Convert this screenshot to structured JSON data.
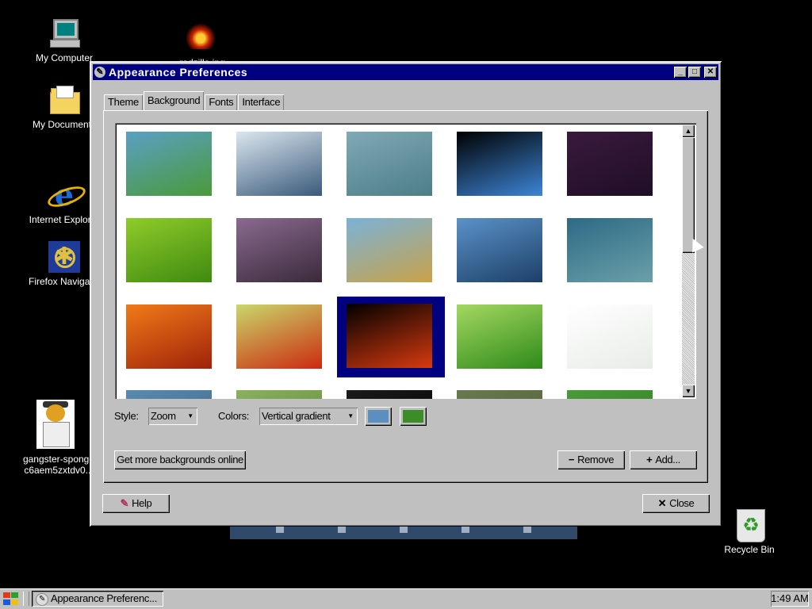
{
  "desktop": {
    "icons": [
      {
        "label": "My Computer"
      },
      {
        "label": "My Documents"
      },
      {
        "label": "Internet Explorer"
      },
      {
        "label": "Firefox Navigator"
      },
      {
        "label": "gangster-sponge",
        "label2": "c6aem5zxtdv0..."
      },
      {
        "label": "radzilla.jpg"
      },
      {
        "label": "Recycle Bin"
      }
    ]
  },
  "window": {
    "title": "Appearance Preferences",
    "controls": {
      "minimize": "_",
      "maximize": "□",
      "close": "✕"
    },
    "tabs": [
      {
        "label": "Theme"
      },
      {
        "label": "Background",
        "active": true
      },
      {
        "label": "Fonts"
      },
      {
        "label": "Interface"
      }
    ],
    "thumbnails": [
      {
        "name": "green-blue gradient",
        "colors": [
          "#5a9fc4",
          "#4a9a3a"
        ]
      },
      {
        "name": "water drop",
        "colors": [
          "#dbe6ef",
          "#3a5a7a"
        ]
      },
      {
        "name": "teal blur",
        "colors": [
          "#7fa9b6",
          "#4d7e86"
        ]
      },
      {
        "name": "arch rainbow",
        "colors": [
          "#000000",
          "#3d85d6"
        ]
      },
      {
        "name": "purple bubbles",
        "colors": [
          "#3a1a3e",
          "#1f0d26"
        ]
      },
      {
        "name": "green leaf",
        "colors": [
          "#8fcc2a",
          "#3f8a10"
        ]
      },
      {
        "name": "nebula",
        "colors": [
          "#8a6a90",
          "#3a2a3a"
        ]
      },
      {
        "name": "wheat grass",
        "colors": [
          "#7bb2d8",
          "#c9a248"
        ]
      },
      {
        "name": "blue waves",
        "colors": [
          "#5a92c8",
          "#1d3f68"
        ]
      },
      {
        "name": "teal dots",
        "colors": [
          "#2d6a86",
          "#6aa0a8"
        ]
      },
      {
        "name": "orange flower",
        "colors": [
          "#f07a18",
          "#a0220a"
        ]
      },
      {
        "name": "red flower",
        "colors": [
          "#c8d86a",
          "#cc2a10"
        ]
      },
      {
        "name": "fire logo",
        "colors": [
          "#000000",
          "#d83a10"
        ],
        "selected": true
      },
      {
        "name": "green grass",
        "colors": [
          "#a4d860",
          "#2e8a1a"
        ]
      },
      {
        "name": "white swirl",
        "colors": [
          "#ffffff",
          "#e8ece8"
        ]
      },
      {
        "name": "row4-a",
        "colors": [
          "#5a8ab0",
          "#3a6080"
        ]
      },
      {
        "name": "row4-b",
        "colors": [
          "#8ab060",
          "#5a8030"
        ]
      },
      {
        "name": "row4-c",
        "colors": [
          "#1a1a1a",
          "#000000"
        ]
      },
      {
        "name": "row4-d",
        "colors": [
          "#6a7a50",
          "#4a5a30"
        ]
      },
      {
        "name": "row4-e",
        "colors": [
          "#4a9a3a",
          "#2a7a1a"
        ]
      }
    ],
    "style_label": "Style:",
    "style_value": "Zoom",
    "colors_label": "Colors:",
    "colors_value": "Vertical gradient",
    "color1": "#5b8fc0",
    "color2": "#3c8c28",
    "get_more_label": "Get more backgrounds online",
    "remove_label": "Remove",
    "add_label": "Add...",
    "help_label": "Help",
    "close_label": "Close"
  },
  "taskbar": {
    "task_label": "Appearance Preferenc...",
    "clock": "1:49 AM"
  }
}
